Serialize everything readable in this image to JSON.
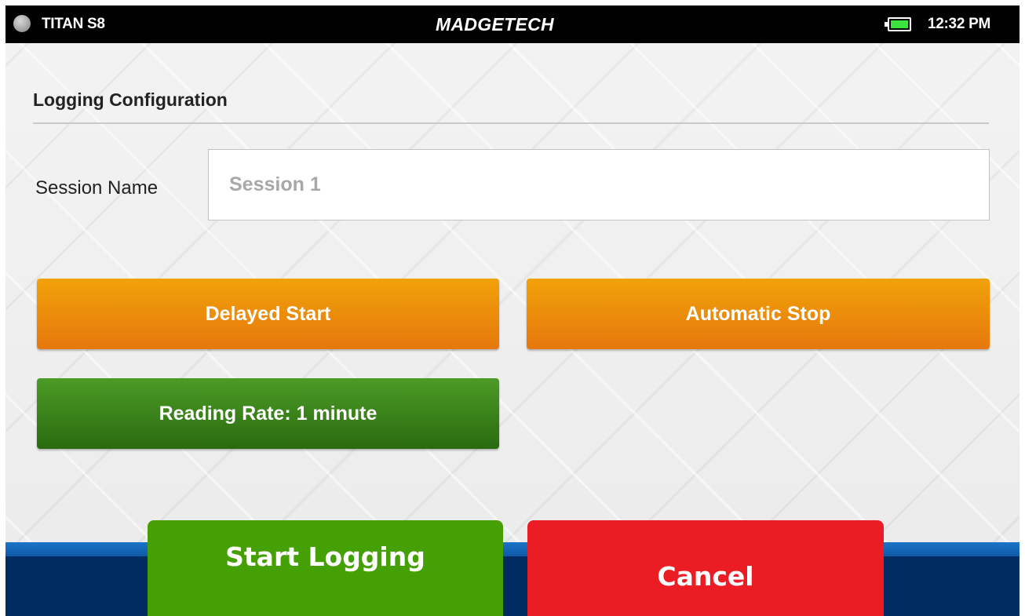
{
  "status_bar": {
    "device_name": "TITAN S8",
    "brand": "MADGETECH",
    "time": "12:32 PM",
    "status_icon": "status-dot-icon",
    "battery_icon": "battery-icon"
  },
  "page": {
    "title": "Logging Configuration"
  },
  "session": {
    "label": "Session Name",
    "value": "",
    "placeholder": "Session 1"
  },
  "buttons": {
    "delayed_start": "Delayed Start",
    "automatic_stop": "Automatic Stop",
    "reading_rate": "Reading Rate: 1 minute"
  },
  "footer": {
    "start_logging": "Start Logging",
    "cancel": "Cancel"
  },
  "colors": {
    "orange": "#e98a0c",
    "dark_green": "#3a8219",
    "start_green": "#45a005",
    "cancel_red": "#ec1c24",
    "footer_navy": "#002c62",
    "footer_blue": "#1565b8",
    "battery_green": "#3ee43e"
  }
}
